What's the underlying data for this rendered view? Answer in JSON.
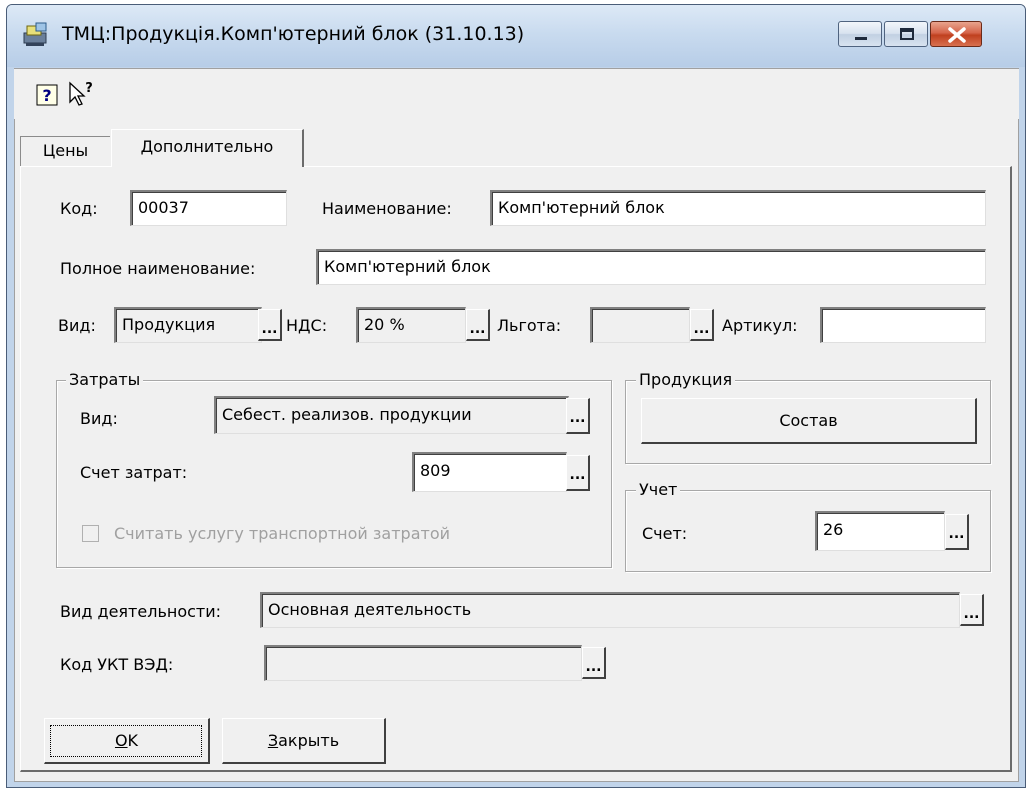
{
  "window": {
    "title": "ТМЦ:Продукція.Комп'ютерний блок (31.10.13)"
  },
  "tabs": [
    {
      "label": "Цены"
    },
    {
      "label": "Дополнительно"
    }
  ],
  "form": {
    "code_label": "Код:",
    "code_value": "00037",
    "name_label": "Наименование:",
    "name_value": "Комп'ютерний блок",
    "fullname_label": "Полное наименование:",
    "fullname_value": "Комп'ютерний блок",
    "kind_label": "Вид:",
    "kind_value": "Продукция",
    "vat_label": "НДС:",
    "vat_value": "20 %",
    "benefit_label": "Льгота:",
    "benefit_value": "",
    "article_label": "Артикул:",
    "article_value": "",
    "ellipsis": "..."
  },
  "costs_group": {
    "title": "Затраты",
    "kind_label": "Вид:",
    "kind_value": "Себест. реализов. продукции",
    "account_label": "Счет затрат:",
    "account_value": "809",
    "transport_checkbox_label": "Считать услугу транспортной затратой",
    "transport_checked": false
  },
  "product_group": {
    "title": "Продукция",
    "composition_button": "Состав"
  },
  "accounting_group": {
    "title": "Учет",
    "account_label": "Счет:",
    "account_value": "26"
  },
  "activity": {
    "label": "Вид деятельности:",
    "value": "Основная деятельность"
  },
  "ukt": {
    "label": "Код УКТ ВЭД:",
    "value": ""
  },
  "buttons": {
    "ok_mnemonic": "O",
    "ok_rest": "K",
    "close_mnemonic": "З",
    "close_rest": "акрыть"
  },
  "colors": {
    "dialog_bg": "#f0f0f0",
    "title_bar": "#c9dbef",
    "close_button": "#c8472a"
  }
}
